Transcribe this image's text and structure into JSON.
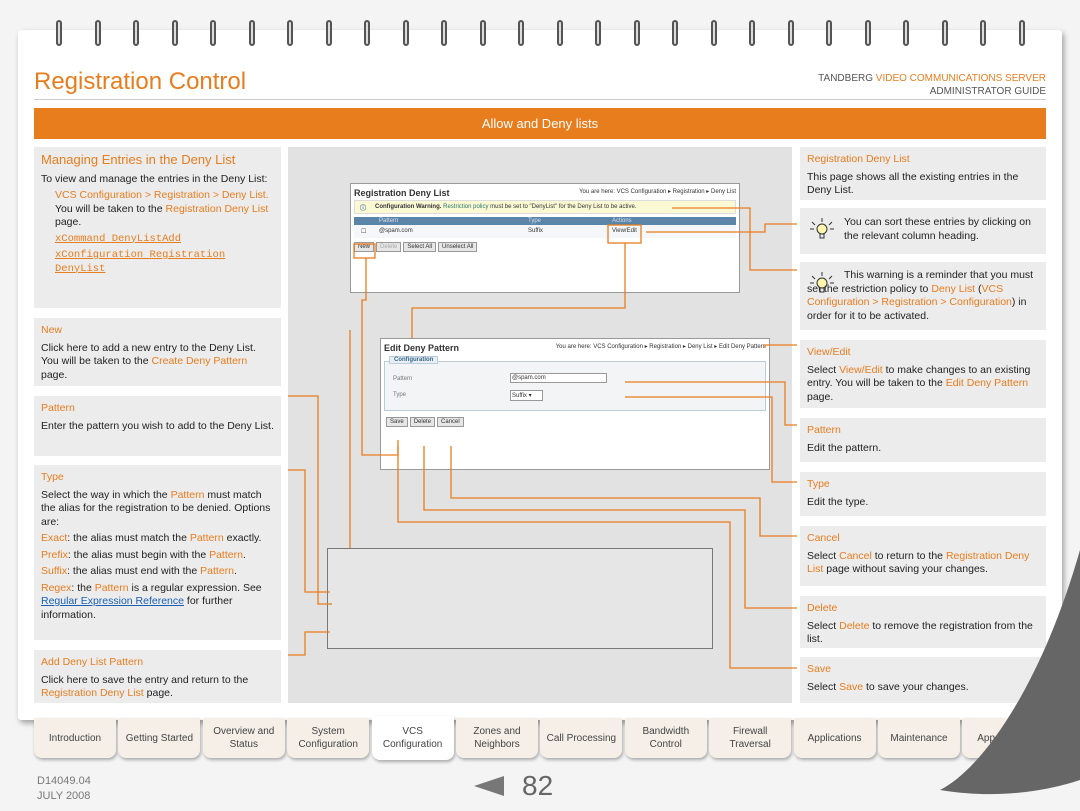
{
  "header": {
    "title": "Registration Control",
    "brand_a": "TANDBERG ",
    "brand_b": "VIDEO COMMUNICATIONS SERVER",
    "guide": "ADMINISTRATOR GUIDE",
    "section": "Allow and Deny lists"
  },
  "left": {
    "managing": {
      "title": "Managing Entries in the Deny List",
      "intro": "To view and manage the entries in the Deny List:",
      "b1": "VCS Configuration > Registration > Deny List.",
      "b1b_pre": "You will be taken to the ",
      "b1b_link": "Registration Deny List",
      "b1b_post": " page.",
      "b2": "xCommand DenyListAdd",
      "b3": "xConfiguration Registration DenyList"
    },
    "new": {
      "title": "New",
      "t1": "Click here to add a new entry to the Deny List. You will be taken to the ",
      "link": "Create Deny Pattern",
      "t2": " page."
    },
    "pattern": {
      "title": "Pattern",
      "text": "Enter the pattern you wish to add to the Deny List."
    },
    "type": {
      "title": "Type",
      "t1": "Select the way in which the ",
      "k1": "Pattern",
      "t2": " must match the alias for the registration to be denied. Options are:",
      "exact": "Exact",
      "exact_t": ": the alias must match the ",
      "exact_t2": " exactly.",
      "prefix": "Prefix",
      "prefix_t": ": the alias must begin with the ",
      "suffix": "Suffix",
      "suffix_t": ": the alias must end with the ",
      "regex": "Regex",
      "regex_t": ": the ",
      "regex_t2": " is a regular expression. See ",
      "regex_link": "Regular Expression Reference",
      "regex_t3": " for further information.",
      "pattern": "Pattern",
      "dot": "."
    },
    "add": {
      "title": "Add Deny List Pattern",
      "t1": "Click here to save the entry and return to the ",
      "link": "Registration Deny List",
      "t2": " page."
    }
  },
  "shot1": {
    "title": "Registration Deny List",
    "crumb": "You are here: VCS Configuration ▸ Registration ▸ Deny List",
    "warn_b": "Configuration Warning.",
    "warn_link": "Restriction policy",
    "warn_t": " must be set to \"DenyList\" for the Deny List to be active.",
    "col_pattern": "Pattern",
    "col_type": "Type",
    "col_actions": "Actions",
    "row_pattern": "@spam.com",
    "row_type": "Suffix",
    "row_action": "View/Edit",
    "btn_new": "New",
    "btn_delete": "Delete",
    "btn_select": "Select All",
    "btn_unselect": "Unselect All"
  },
  "shot2": {
    "title": "Edit Deny Pattern",
    "crumb": "You are here: VCS Configuration ▸ Registration ▸ Deny List ▸ Edit Deny Pattern",
    "fieldset": "Configuration",
    "label_pattern": "Pattern",
    "value_pattern": "@spam.com",
    "label_type": "Type",
    "value_type": "Suffix",
    "btn_save": "Save",
    "btn_delete": "Delete",
    "btn_cancel": "Cancel"
  },
  "right": {
    "deny": {
      "title": "Registration Deny List",
      "text": "This page shows all the existing entries in the Deny List."
    },
    "tip1": "You can sort these entries by clicking on the relevant column heading.",
    "tip2": {
      "t1": "This warning is a reminder that you must set the restriction policy to ",
      "k1": "Deny List",
      "t2": " (",
      "k2": "VCS Configuration > Registration > Configuration",
      "t3": ") in order for it to be activated."
    },
    "view": {
      "title": "View/Edit",
      "t1": "Select ",
      "k1": "View/Edit",
      "t2": " to make changes to an existing entry. You will be taken to the ",
      "k2": "Edit Deny Pattern",
      "t3": " page."
    },
    "pattern": {
      "title": "Pattern",
      "text": "Edit the pattern."
    },
    "type": {
      "title": "Type",
      "text": "Edit the type."
    },
    "cancel": {
      "title": "Cancel",
      "t1": "Select ",
      "k1": "Cancel",
      "t2": " to return to the ",
      "k2": "Registration Deny List",
      "t3": " page without saving your changes."
    },
    "delete": {
      "title": "Delete",
      "t1": "Select ",
      "k1": "Delete",
      "t2": " to remove the registration from the list."
    },
    "save": {
      "title": "Save",
      "t1": "Select ",
      "k1": "Save",
      "t2": " to save your changes."
    }
  },
  "tabs": [
    {
      "label": "Introduction"
    },
    {
      "label": "Getting Started"
    },
    {
      "label": "Overview and Status"
    },
    {
      "label": "System Configuration"
    },
    {
      "label": "VCS Configuration",
      "active": true
    },
    {
      "label": "Zones and Neighbors"
    },
    {
      "label": "Call Processing"
    },
    {
      "label": "Bandwidth Control"
    },
    {
      "label": "Firewall Traversal"
    },
    {
      "label": "Applications"
    },
    {
      "label": "Maintenance"
    },
    {
      "label": "Appendices"
    }
  ],
  "footer": {
    "doc": "D14049.04",
    "date": "JULY 2008",
    "page": "82"
  },
  "colors": {
    "accent": "#e87d1e"
  }
}
